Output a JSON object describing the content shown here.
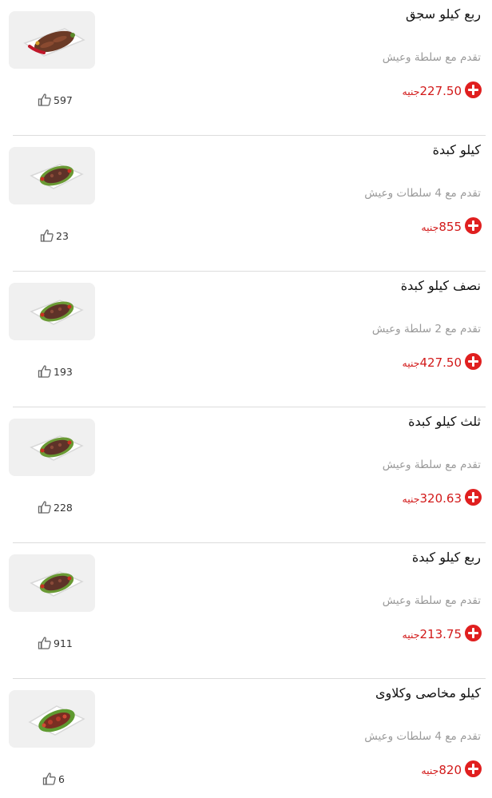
{
  "menu": {
    "items": [
      {
        "name": "ربع كيلو سجق",
        "description": "تقدم مع سلطة وعيش",
        "price": "227.50",
        "currency": "جنيه",
        "likes": "597",
        "image_icon": "sausage-dish-image"
      },
      {
        "name": "كيلو كبدة",
        "description": "تقدم مع 4 سلطات وعيش",
        "price": "855",
        "currency": "جنيه",
        "likes": "23",
        "image_icon": "liver-dish-image"
      },
      {
        "name": "نصف كيلو كبدة",
        "description": "تقدم مع 2 سلطة وعيش",
        "price": "427.50",
        "currency": "جنيه",
        "likes": "193",
        "image_icon": "liver-dish-image"
      },
      {
        "name": "ثلث كيلو كبدة",
        "description": "تقدم مع سلطة وعيش",
        "price": "320.63",
        "currency": "جنيه",
        "likes": "228",
        "image_icon": "liver-dish-image"
      },
      {
        "name": "ربع كيلو كبدة",
        "description": "تقدم مع سلطة وعيش",
        "price": "213.75",
        "currency": "جنيه",
        "likes": "911",
        "image_icon": "liver-dish-image"
      },
      {
        "name": "كيلو مخاصى وكلاوى",
        "description": "تقدم مع 4 سلطات وعيش",
        "price": "820",
        "currency": "جنيه",
        "likes": "6",
        "image_icon": "kidney-dish-image"
      }
    ]
  },
  "colors": {
    "accent": "#e01f1f",
    "price": "#d21a1a",
    "title": "#111111",
    "description": "#9a9a9a",
    "divider": "#dcdcdc"
  },
  "icons": {
    "like": "thumbs-up-icon",
    "add": "plus-circle-icon"
  }
}
